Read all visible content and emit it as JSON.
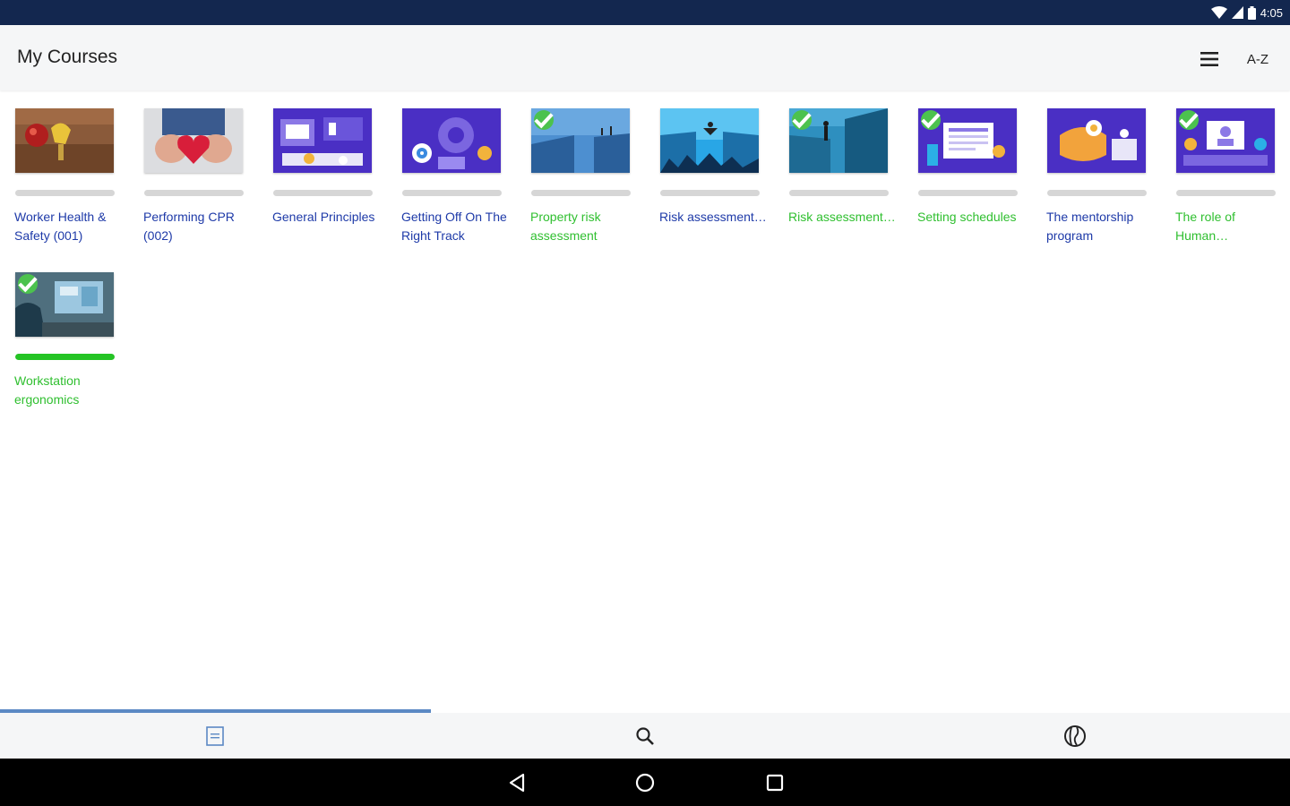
{
  "status_bar": {
    "time": "4:05",
    "icons": [
      "wifi-icon",
      "cell-signal-icon",
      "battery-icon"
    ]
  },
  "header": {
    "title": "My Courses",
    "menu_icon": "menu-icon",
    "sort_label": "A-Z"
  },
  "colors": {
    "accent_blue": "#1e3aa8",
    "complete_green": "#2fbf2f",
    "status_bar": "#13274f",
    "tab_indicator": "#5b89c4"
  },
  "courses": [
    {
      "title": "Worker Health & Safety (001)",
      "completed": false,
      "progress": 0
    },
    {
      "title": "Performing CPR (002)",
      "completed": false,
      "progress": 0
    },
    {
      "title": "General Principles",
      "completed": false,
      "progress": 0
    },
    {
      "title": "Getting Off On The Right Track",
      "completed": false,
      "progress": 0
    },
    {
      "title": "Property risk assessment",
      "completed": true,
      "progress": 0
    },
    {
      "title": "Risk assessment…",
      "completed": false,
      "progress": 0
    },
    {
      "title": "Risk assessment…",
      "completed": true,
      "progress": 0
    },
    {
      "title": "Setting schedules",
      "completed": true,
      "progress": 0
    },
    {
      "title": "The mentorship program",
      "completed": false,
      "progress": 0
    },
    {
      "title": "The role of Human…",
      "completed": true,
      "progress": 0
    },
    {
      "title": "Workstation ergonomics",
      "completed": true,
      "progress": 1
    }
  ],
  "bottom_nav": {
    "items": [
      "courses-tab-icon",
      "search-icon",
      "globe-icon"
    ],
    "active_index": 0
  },
  "system_nav": {
    "items": [
      "back-icon",
      "home-icon",
      "recents-icon"
    ]
  }
}
